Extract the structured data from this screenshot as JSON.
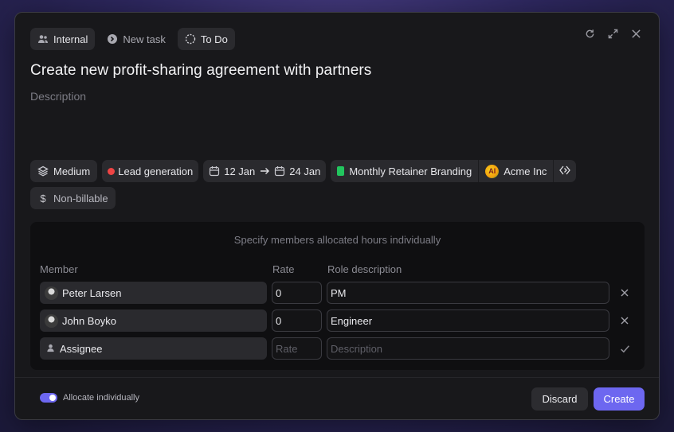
{
  "top": {
    "chips": [
      {
        "label": "Internal",
        "icon": "users-icon"
      },
      {
        "label": "New task",
        "icon": "arrow-circle-icon"
      },
      {
        "label": "To Do",
        "icon": "dashed-circle-icon"
      }
    ]
  },
  "window_controls": [
    "refresh-icon",
    "expand-icon",
    "close-icon"
  ],
  "task": {
    "title": "Create new profit-sharing agreement with partners",
    "description_placeholder": "Description"
  },
  "properties": {
    "priority": "Medium",
    "category": "Lead generation",
    "start_date": "12 Jan",
    "end_date": "24 Jan",
    "project": "Monthly Retainer Branding",
    "client_logo_text": "AI",
    "client": "Acme Inc",
    "billing": "Non-billable"
  },
  "allocation": {
    "caption": "Specify members allocated hours individually",
    "headers": {
      "member": "Member",
      "rate": "Rate",
      "role": "Role description"
    },
    "rows": [
      {
        "member": "Peter Larsen",
        "rate": "0",
        "role": "PM",
        "action": "remove-icon"
      },
      {
        "member": "John Boyko",
        "rate": "0",
        "role": "Engineer",
        "action": "remove-icon"
      }
    ],
    "new_row": {
      "member": "Assignee",
      "rate_placeholder": "Rate",
      "role_placeholder": "Description",
      "action": "check-icon"
    }
  },
  "footer": {
    "toggle_label": "Allocate individually",
    "toggle_on": true,
    "discard_label": "Discard",
    "create_label": "Create"
  },
  "colors": {
    "accent": "#6d67f0",
    "category_dot": "#ef4444",
    "project_tag": "#22c55e"
  }
}
